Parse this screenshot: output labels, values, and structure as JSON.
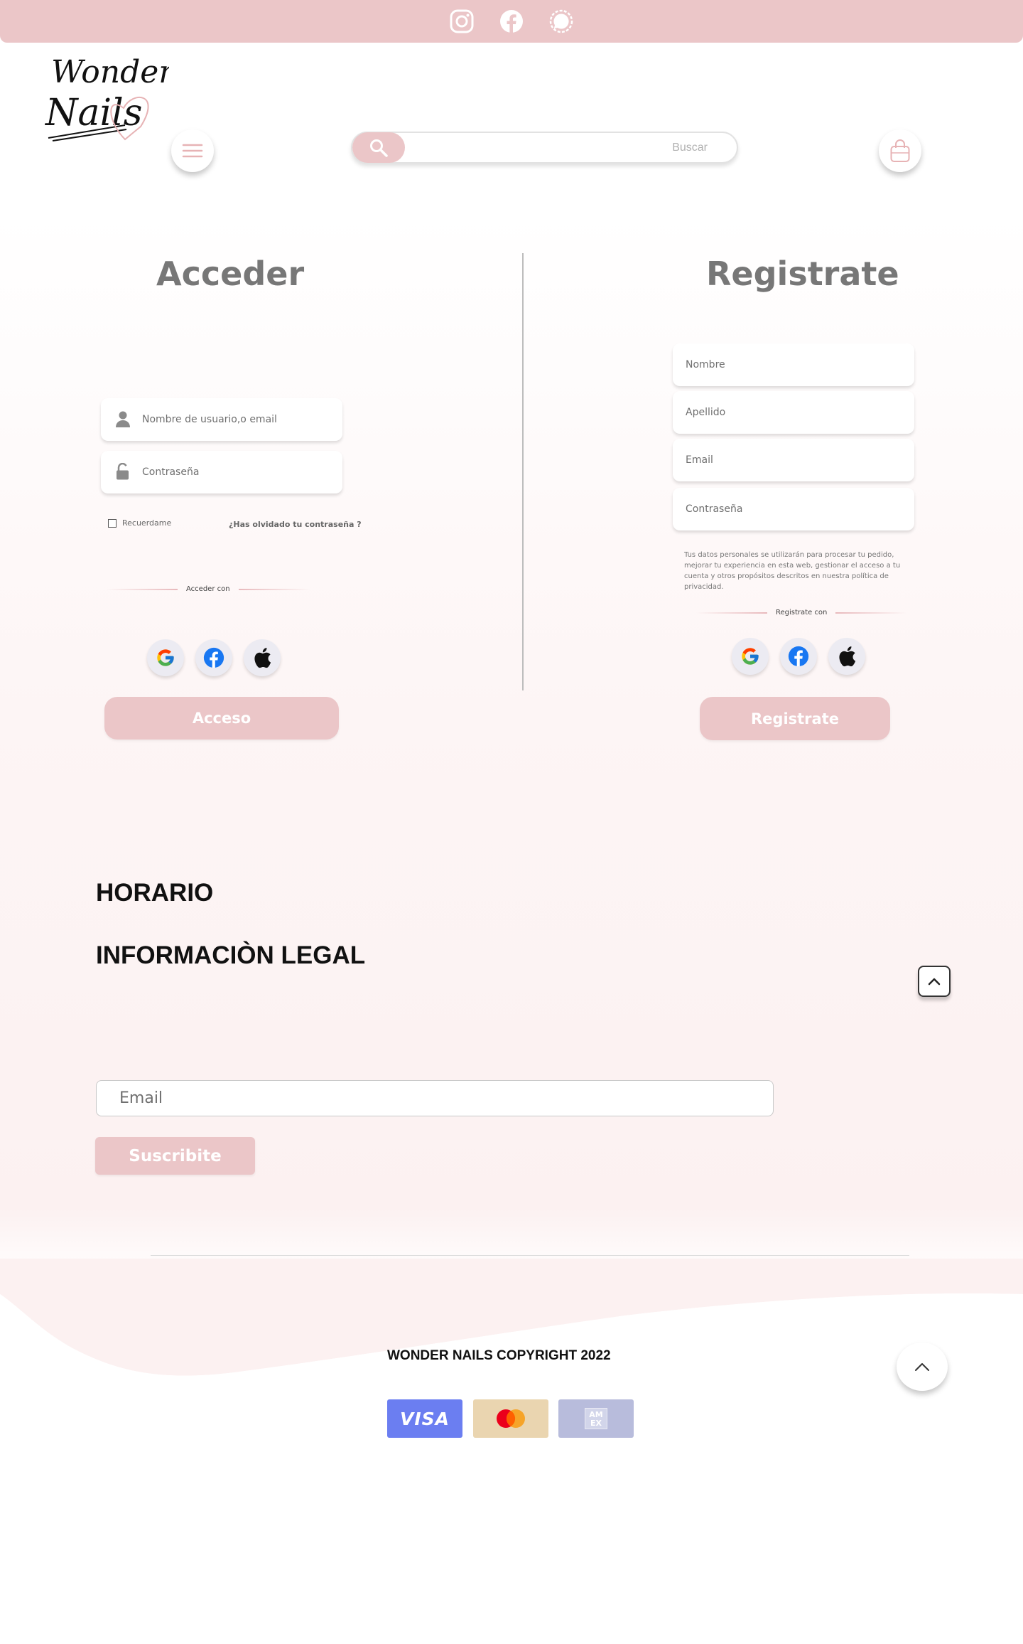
{
  "brand": {
    "logo_line1": "Wonder",
    "logo_line2": "Nails",
    "accent_color": "#ebc6c8"
  },
  "topbar": {
    "icons": [
      "instagram-icon",
      "facebook-icon",
      "signal-icon"
    ]
  },
  "header": {
    "menu_icon": "hamburger-icon",
    "cart_icon": "shopping-bag-icon",
    "search": {
      "placeholder": "Buscar",
      "icon": "search-icon"
    }
  },
  "login": {
    "title": "Acceder",
    "username_placeholder": "Nombre de usuario,o email",
    "password_placeholder": "Contraseña",
    "remember_label": "Recuerdame",
    "forgot_label": "¿Has olvidado tu contraseña ?",
    "social_label": "Acceder con",
    "submit_label": "Acceso"
  },
  "register": {
    "title": "Registrate",
    "nombre_placeholder": "Nombre",
    "apellido_placeholder": "Apellido",
    "email_placeholder": "Email",
    "password_placeholder": "Contraseña",
    "privacy_text": "Tus datos personales se utilizarán para procesar tu pedido, mejorar tu experiencia en esta web, gestionar el acceso a tu cuenta y otros propósitos descritos en nuestra política de privacidad.",
    "social_label": "Registrate con",
    "submit_label": "Registrate"
  },
  "social_providers": [
    "google-icon",
    "facebook-icon",
    "apple-icon"
  ],
  "footer": {
    "horario_label": "HORARIO",
    "legal_label": "INFORMACIÒN LEGAL",
    "newsletter_placeholder": "Email",
    "subscribe_label": "Suscribite",
    "copyright": "WONDER NAILS  COPYRIGHT 2022",
    "payments": {
      "visa": "VISA",
      "amex_line1": "AM",
      "amex_line2": "EX"
    }
  }
}
